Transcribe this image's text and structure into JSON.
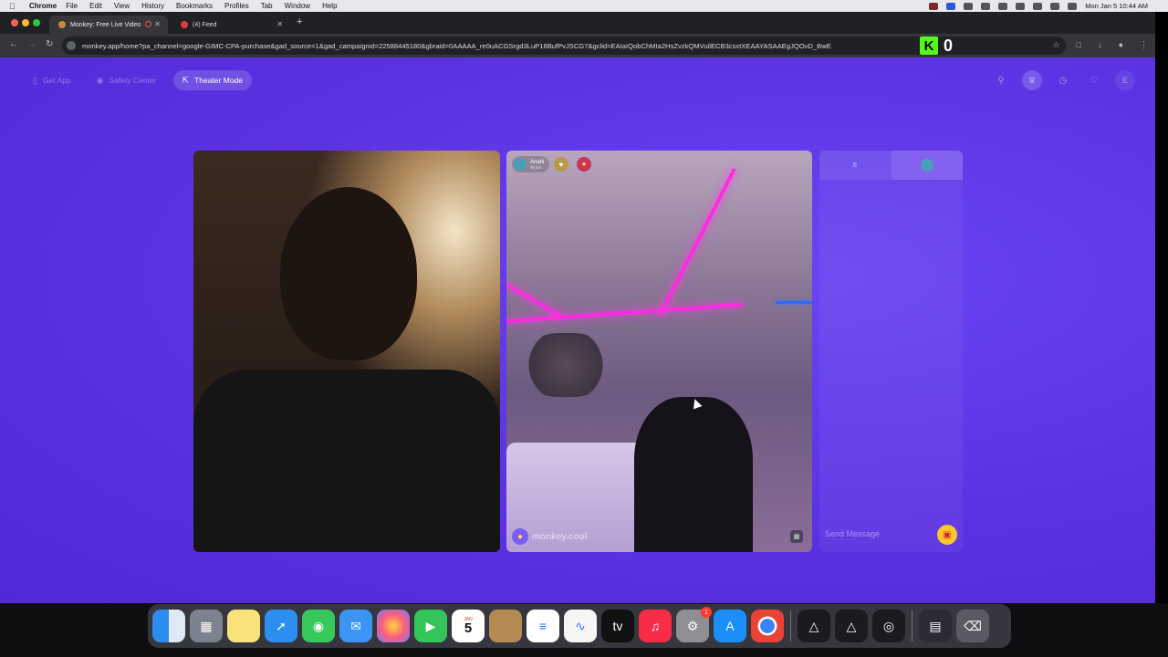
{
  "menubar": {
    "app_name": "Chrome",
    "menus": [
      "File",
      "Edit",
      "View",
      "History",
      "Bookmarks",
      "Profiles",
      "Tab",
      "Window",
      "Help"
    ],
    "clock": "Mon Jan 5  10:44 AM"
  },
  "browser": {
    "tabs": [
      {
        "title": "Monkey: Free Live Video",
        "active": true
      },
      {
        "title": "(4) Feed",
        "active": false
      }
    ],
    "url": "monkey.app/home?pa_channel=google-GIMC-CPA-purchase&gad_source=1&gad_campaignid=22588445180&gbraid=0AAAAA_re0uACGSrgd3LuP16BufPvJSCG7&gclid=EAIaIQobChMIa2HsZvzkQMVuilECB3csxtXEAAYASAAEgJQOvD_BwE",
    "kick_count": "0",
    "kick_letter": "K"
  },
  "page": {
    "nav": {
      "get_app": "Get App",
      "safety_center": "Safety Center",
      "theater_mode": "Theater Mode"
    },
    "user_initial": "E",
    "partner": {
      "name": "Anahi",
      "location": "Illinois"
    },
    "watermark": "monkey.cool",
    "chat": {
      "me_initial": "E",
      "placeholder": "Send Message"
    }
  },
  "dock": {
    "calendar_month": "JAN",
    "calendar_day": "5",
    "settings_badge": "1",
    "apple_tv_label": "tv",
    "apps": [
      "Finder",
      "Launchpad",
      "Notes",
      "Safari",
      "Messages",
      "Mail",
      "Photos",
      "FaceTime",
      "Calendar",
      "Contacts",
      "Reminders",
      "Freeform",
      "TV",
      "Music",
      "System Settings",
      "App Store",
      "Chrome",
      "Affinity",
      "Affinity 2",
      "OBS",
      "Screen",
      "Trash"
    ]
  },
  "colors": {
    "page_bg": "#5a30e0",
    "neon": "#ff2be0",
    "kick_green": "#53fc18",
    "gift_yellow": "#f8c82a"
  }
}
